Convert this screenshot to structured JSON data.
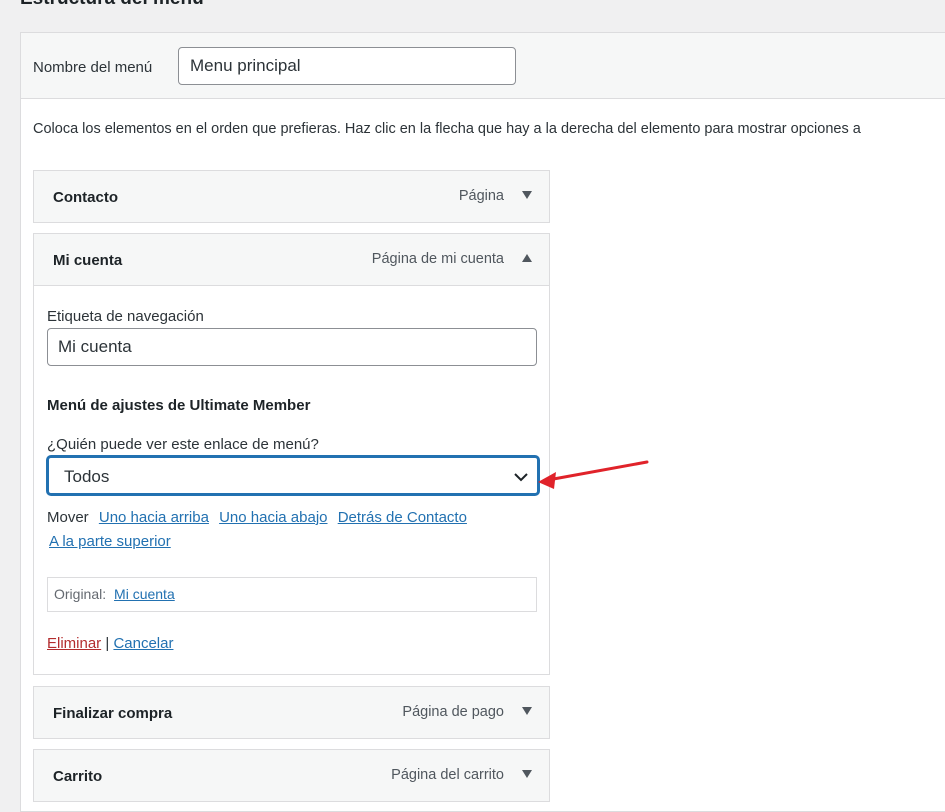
{
  "page": {
    "heading": "Estructura del menú"
  },
  "menu": {
    "name_label": "Nombre del menú",
    "name_value": "Menu principal",
    "instructions": "Coloca los elementos en el orden que prefieras. Haz clic en la flecha que hay a la derecha del elemento para mostrar opciones a"
  },
  "items": [
    {
      "title": "Contacto",
      "type": "Página",
      "state": "collapsed"
    },
    {
      "title": "Mi cuenta",
      "type": "Página de mi cuenta",
      "state": "expanded"
    },
    {
      "title": "Finalizar compra",
      "type": "Página de pago",
      "state": "collapsed"
    },
    {
      "title": "Carrito",
      "type": "Página del carrito",
      "state": "collapsed"
    }
  ],
  "settings": {
    "nav_label": "Etiqueta de navegación",
    "nav_value": "Mi cuenta",
    "section_title": "Menú de ajustes de Ultimate Member",
    "visibility_label": "¿Quién puede ver este enlace de menú?",
    "visibility_value": "Todos",
    "move_label": "Mover",
    "move_links": [
      "Uno hacia arriba",
      "Uno hacia abajo",
      "Detrás de Contacto",
      "A la parte superior"
    ],
    "original_label": "Original:",
    "original_link": "Mi cuenta",
    "delete_label": "Eliminar",
    "separator": "|",
    "cancel_label": "Cancelar"
  },
  "icons": {
    "collapsed_toggle": "triangle-down-icon",
    "expanded_toggle": "triangle-up-icon",
    "select_chevron": "chevron-down-icon",
    "annotation": "red-arrow"
  },
  "colors": {
    "link": "#2271b1",
    "delete": "#b32d2e",
    "focus": "#2271b1",
    "annotation_arrow": "#e0232a"
  }
}
